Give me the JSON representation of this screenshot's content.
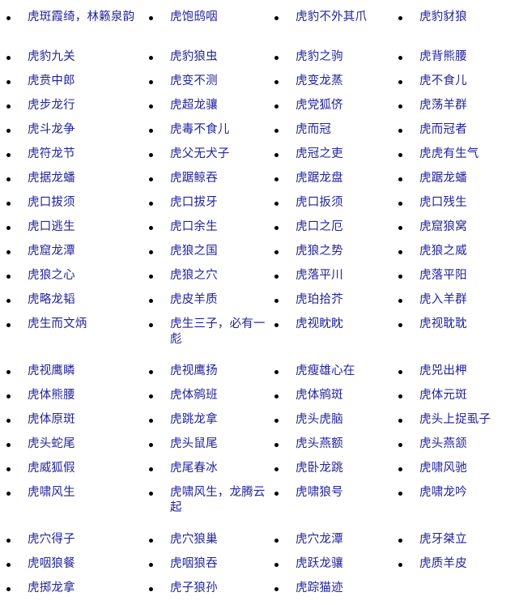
{
  "page": {
    "title": "虎字成语列表",
    "text_color": "#22229c",
    "bullet_color": "#000000",
    "background_color": "#ffffff",
    "column_count": 4
  },
  "columns": [
    {
      "index": 1,
      "items": [
        {
          "text": "虎斑霞绮，林籁泉韵",
          "wrap": true,
          "row": "r-h2"
        },
        {
          "text": "虎豹九关",
          "wrap": false,
          "row": "r-h1"
        },
        {
          "text": "虎贲中郎",
          "wrap": false,
          "row": "r-h1"
        },
        {
          "text": "虎步龙行",
          "wrap": false,
          "row": "r-h1"
        },
        {
          "text": "虎斗龙争",
          "wrap": false,
          "row": "r-h1"
        },
        {
          "text": "虎符龙节",
          "wrap": false,
          "row": "r-h1"
        },
        {
          "text": "虎据龙蟠",
          "wrap": false,
          "row": "r-h1"
        },
        {
          "text": "虎口拔须",
          "wrap": false,
          "row": "r-h1"
        },
        {
          "text": "虎口逃生",
          "wrap": false,
          "row": "r-h1"
        },
        {
          "text": "虎窟龙潭",
          "wrap": false,
          "row": "r-h1"
        },
        {
          "text": "虎狼之心",
          "wrap": false,
          "row": "r-h1"
        },
        {
          "text": "虎略龙韬",
          "wrap": false,
          "row": "r-h1"
        },
        {
          "text": "虎生而文炳",
          "wrap": false,
          "row": "r-h3"
        },
        {
          "text": "虎视鹰瞵",
          "wrap": false,
          "row": "r-h1"
        },
        {
          "text": "虎体熊腰",
          "wrap": false,
          "row": "r-h1"
        },
        {
          "text": "虎体原斑",
          "wrap": false,
          "row": "r-h1"
        },
        {
          "text": "虎头蛇尾",
          "wrap": false,
          "row": "r-h1"
        },
        {
          "text": "虎威狐假",
          "wrap": false,
          "row": "r-h1"
        },
        {
          "text": "虎啸风生",
          "wrap": false,
          "row": "r-h3"
        },
        {
          "text": "虎穴得子",
          "wrap": false,
          "row": "r-h1"
        },
        {
          "text": "虎咽狼餐",
          "wrap": false,
          "row": "r-h1"
        },
        {
          "text": "虎掷龙拿",
          "wrap": false,
          "row": "r-h1"
        }
      ]
    },
    {
      "index": 2,
      "items": [
        {
          "text": "虎饱鸱咽",
          "wrap": false,
          "row": "r-h2"
        },
        {
          "text": "虎豹狼虫",
          "wrap": false,
          "row": "r-h1"
        },
        {
          "text": "虎变不测",
          "wrap": false,
          "row": "r-h1"
        },
        {
          "text": "虎超龙骧",
          "wrap": false,
          "row": "r-h1"
        },
        {
          "text": "虎毒不食儿",
          "wrap": false,
          "row": "r-h1"
        },
        {
          "text": "虎父无犬子",
          "wrap": false,
          "row": "r-h1"
        },
        {
          "text": "虎踞鲸吞",
          "wrap": false,
          "row": "r-h1"
        },
        {
          "text": "虎口拔牙",
          "wrap": false,
          "row": "r-h1"
        },
        {
          "text": "虎口余生",
          "wrap": false,
          "row": "r-h1"
        },
        {
          "text": "虎狼之国",
          "wrap": false,
          "row": "r-h1"
        },
        {
          "text": "虎狼之穴",
          "wrap": false,
          "row": "r-h1"
        },
        {
          "text": "虎皮羊质",
          "wrap": false,
          "row": "r-h1"
        },
        {
          "text": "虎生三子，必有一彪",
          "wrap": true,
          "row": "r-h3"
        },
        {
          "text": "虎视鹰扬",
          "wrap": false,
          "row": "r-h1"
        },
        {
          "text": "虎体鹓班",
          "wrap": false,
          "row": "r-h1"
        },
        {
          "text": "虎跳龙拿",
          "wrap": false,
          "row": "r-h1"
        },
        {
          "text": "虎头鼠尾",
          "wrap": false,
          "row": "r-h1"
        },
        {
          "text": "虎尾春冰",
          "wrap": false,
          "row": "r-h1"
        },
        {
          "text": "虎啸风生，龙腾云起",
          "wrap": true,
          "row": "r-h3"
        },
        {
          "text": "虎穴狼巢",
          "wrap": false,
          "row": "r-h1"
        },
        {
          "text": "虎咽狼吞",
          "wrap": false,
          "row": "r-h1"
        },
        {
          "text": "虎子狼孙",
          "wrap": false,
          "row": "r-h1"
        }
      ]
    },
    {
      "index": 3,
      "items": [
        {
          "text": "虎豹不外其爪",
          "wrap": false,
          "row": "r-h2"
        },
        {
          "text": "虎豹之驹",
          "wrap": false,
          "row": "r-h1"
        },
        {
          "text": "虎变龙蒸",
          "wrap": false,
          "row": "r-h1"
        },
        {
          "text": "虎党狐侪",
          "wrap": false,
          "row": "r-h1"
        },
        {
          "text": "虎而冠",
          "wrap": false,
          "row": "r-h1"
        },
        {
          "text": "虎冠之吏",
          "wrap": false,
          "row": "r-h1"
        },
        {
          "text": "虎踞龙盘",
          "wrap": false,
          "row": "r-h1"
        },
        {
          "text": "虎口扳须",
          "wrap": false,
          "row": "r-h1"
        },
        {
          "text": "虎口之厄",
          "wrap": false,
          "row": "r-h1"
        },
        {
          "text": "虎狼之势",
          "wrap": false,
          "row": "r-h1"
        },
        {
          "text": "虎落平川",
          "wrap": false,
          "row": "r-h1"
        },
        {
          "text": "虎珀拾芥",
          "wrap": false,
          "row": "r-h1"
        },
        {
          "text": "虎视眈眈",
          "wrap": false,
          "row": "r-h3"
        },
        {
          "text": "虎瘦雄心在",
          "wrap": false,
          "row": "r-h1"
        },
        {
          "text": "虎体鹓斑",
          "wrap": false,
          "row": "r-h1"
        },
        {
          "text": "虎头虎脑",
          "wrap": false,
          "row": "r-h1"
        },
        {
          "text": "虎头燕额",
          "wrap": false,
          "row": "r-h1"
        },
        {
          "text": "虎卧龙跳",
          "wrap": false,
          "row": "r-h1"
        },
        {
          "text": "虎啸狼号",
          "wrap": false,
          "row": "r-h3"
        },
        {
          "text": "虎穴龙潭",
          "wrap": false,
          "row": "r-h1"
        },
        {
          "text": "虎跃龙骧",
          "wrap": false,
          "row": "r-h1"
        },
        {
          "text": "虎踪猫迹",
          "wrap": false,
          "row": "r-h1"
        }
      ]
    },
    {
      "index": 4,
      "items": [
        {
          "text": "虎豹豺狼",
          "wrap": false,
          "row": "r-h2"
        },
        {
          "text": "虎背熊腰",
          "wrap": false,
          "row": "r-h1"
        },
        {
          "text": "虎不食儿",
          "wrap": false,
          "row": "r-h1"
        },
        {
          "text": "虎荡羊群",
          "wrap": false,
          "row": "r-h1"
        },
        {
          "text": "虎而冠者",
          "wrap": false,
          "row": "r-h1"
        },
        {
          "text": "虎虎有生气",
          "wrap": false,
          "row": "r-h1"
        },
        {
          "text": "虎踞龙蟠",
          "wrap": false,
          "row": "r-h1"
        },
        {
          "text": "虎口残生",
          "wrap": false,
          "row": "r-h1"
        },
        {
          "text": "虎窟狼窝",
          "wrap": false,
          "row": "r-h1"
        },
        {
          "text": "虎狼之威",
          "wrap": false,
          "row": "r-h1"
        },
        {
          "text": "虎落平阳",
          "wrap": false,
          "row": "r-h1"
        },
        {
          "text": "虎入羊群",
          "wrap": false,
          "row": "r-h1"
        },
        {
          "text": "虎视耽耽",
          "wrap": false,
          "row": "r-h3"
        },
        {
          "text": "虎兕出柙",
          "wrap": false,
          "row": "r-h1"
        },
        {
          "text": "虎体元斑",
          "wrap": false,
          "row": "r-h1"
        },
        {
          "text": "虎头上捉虱子",
          "wrap": false,
          "row": "r-h1"
        },
        {
          "text": "虎头燕颔",
          "wrap": false,
          "row": "r-h1"
        },
        {
          "text": "虎啸风驰",
          "wrap": false,
          "row": "r-h1"
        },
        {
          "text": "虎啸龙吟",
          "wrap": false,
          "row": "r-h3"
        },
        {
          "text": "虎牙桀立",
          "wrap": false,
          "row": "r-h1"
        },
        {
          "text": "虎质羊皮",
          "wrap": false,
          "row": "r-h1"
        }
      ]
    }
  ]
}
